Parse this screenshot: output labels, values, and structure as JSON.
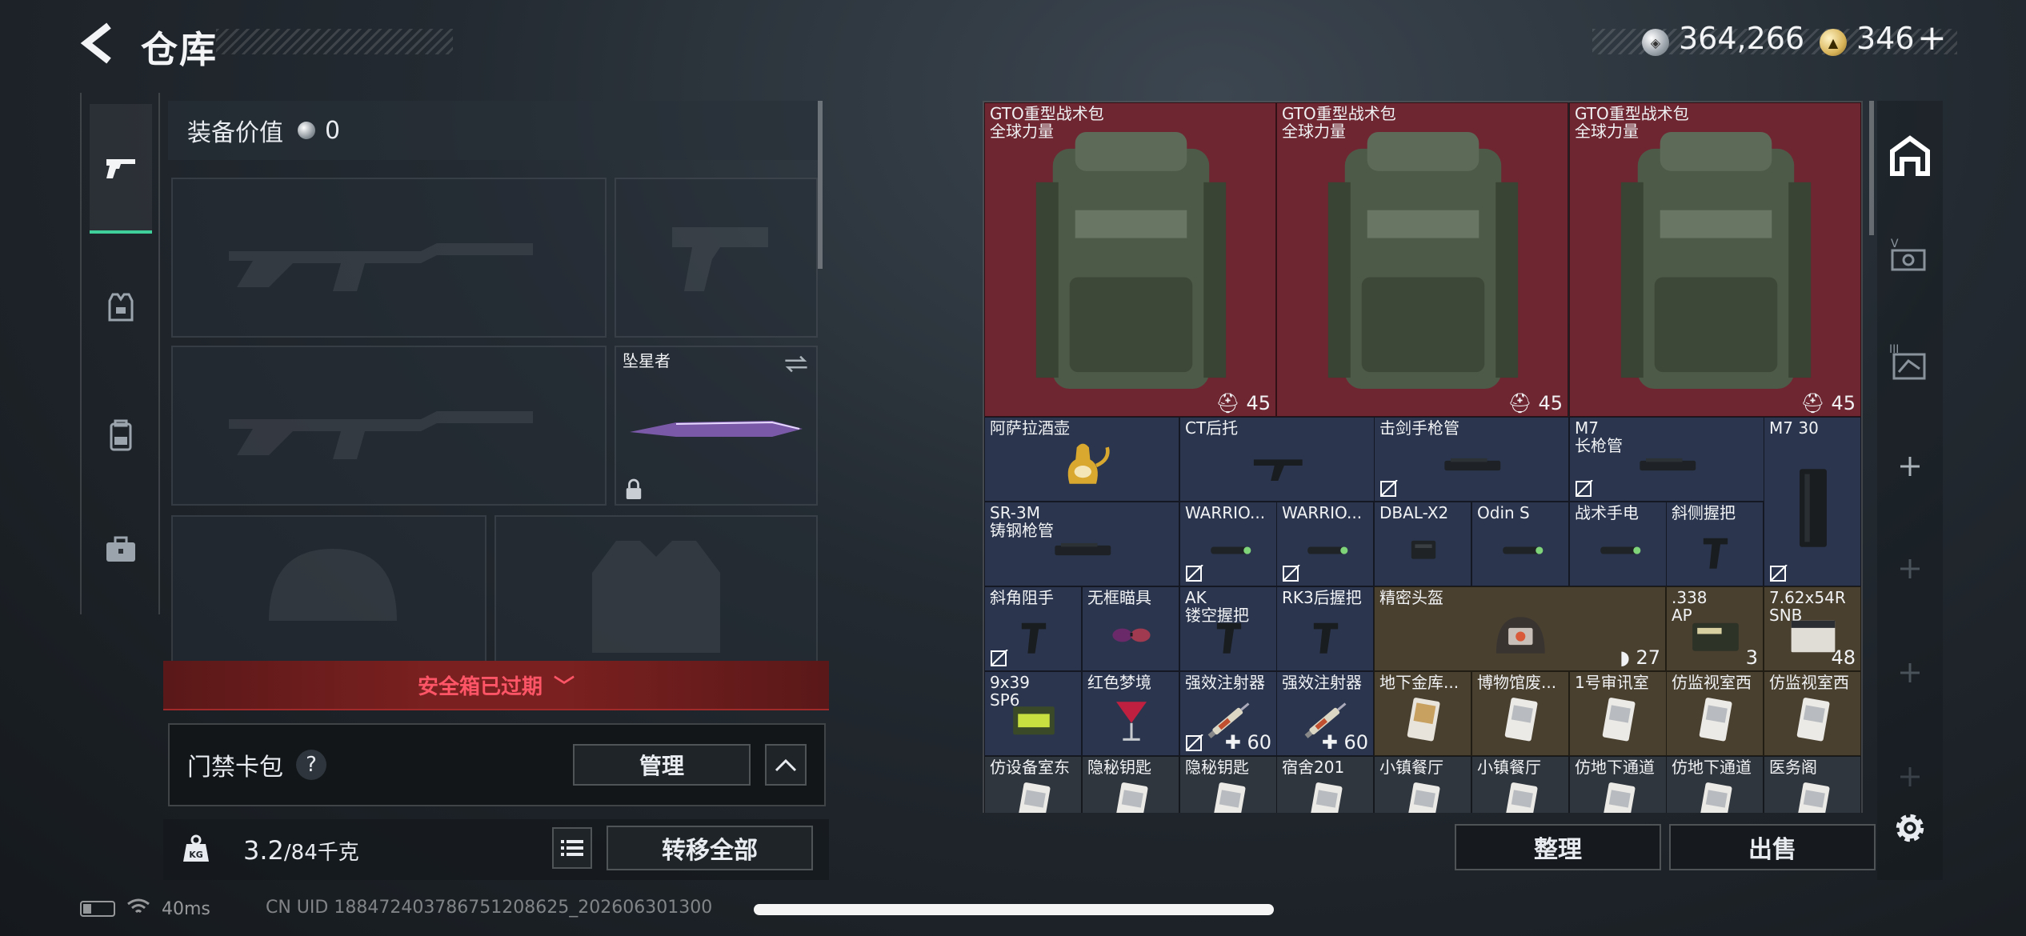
{
  "header": {
    "title": "仓库",
    "silver_amount": "364,266",
    "gold_amount": "346",
    "gold_plus": "+"
  },
  "categories": [
    {
      "name": "weapon",
      "icon": "pistol-icon",
      "active": true
    },
    {
      "name": "armor",
      "icon": "vest-icon",
      "active": false
    },
    {
      "name": "backpack",
      "icon": "backpack-icon",
      "active": false
    },
    {
      "name": "supplies",
      "icon": "briefcase-icon",
      "active": false
    }
  ],
  "equipment": {
    "value_label": "装备价值",
    "value": "0",
    "melee_name": "坠星者"
  },
  "safe_box": {
    "expired_text": "安全箱已过期"
  },
  "card_pack": {
    "label": "门禁卡包",
    "help": "?",
    "manage_label": "管理"
  },
  "weight": {
    "current": "3.2",
    "max": "/84千克",
    "transfer_all_label": "转移全部"
  },
  "inventory": [
    {
      "name": "GTO重型战术包",
      "sub": "全球力量",
      "count": "45",
      "count_icon": "backpack-count-icon",
      "color": "red"
    },
    {
      "name": "GTO重型战术包",
      "sub": "全球力量",
      "count": "45",
      "count_icon": "backpack-count-icon",
      "color": "red"
    },
    {
      "name": "GTO重型战术包",
      "sub": "全球力量",
      "count": "45",
      "count_icon": "backpack-count-icon",
      "color": "red"
    },
    {
      "name": "阿萨拉酒壶",
      "color": "blue"
    },
    {
      "name": "CT后托",
      "color": "blue"
    },
    {
      "name": "击剑手枪管",
      "color": "blue",
      "no_mark": true
    },
    {
      "name": "M7",
      "sub": "长枪管",
      "color": "blue",
      "no_mark": true
    },
    {
      "name": "M7 30",
      "color": "blue",
      "no_mark": true
    },
    {
      "name": "SR-3M",
      "sub": "铸钢枪管",
      "color": "blue"
    },
    {
      "name": "WARRIO...",
      "color": "blue",
      "no_mark": true
    },
    {
      "name": "WARRIO...",
      "color": "blue",
      "no_mark": true
    },
    {
      "name": "DBAL-X2",
      "color": "blue"
    },
    {
      "name": "Odin S",
      "color": "blue"
    },
    {
      "name": "战术手电",
      "color": "blue"
    },
    {
      "name": "斜侧握把",
      "color": "blue"
    },
    {
      "name": "斜角阻手",
      "color": "blue",
      "no_mark": true
    },
    {
      "name": "无框瞄具",
      "color": "blue"
    },
    {
      "name": "AK",
      "sub": "镂空握把",
      "color": "blue"
    },
    {
      "name": "RK3后握把",
      "color": "blue"
    },
    {
      "name": "精密头盔",
      "count": "27",
      "count_icon": "shield-count-icon",
      "color": "olive"
    },
    {
      "name": ".338",
      "sub": "AP",
      "count": "3",
      "color": "olive"
    },
    {
      "name": "7.62x54R",
      "sub": "SNB",
      "count": "48",
      "color": "olive"
    },
    {
      "name": "9x39",
      "sub": "SP6",
      "color": "blue"
    },
    {
      "name": "红色梦境",
      "color": "blue"
    },
    {
      "name": "强效注射器",
      "count": "60",
      "count_icon": "plus-count-icon",
      "color": "blue",
      "no_mark": true
    },
    {
      "name": "强效注射器",
      "count": "60",
      "count_icon": "plus-count-icon",
      "color": "blue"
    },
    {
      "name": "地下金库...",
      "color": "olive"
    },
    {
      "name": "博物馆废...",
      "color": "olive"
    },
    {
      "name": "1号审讯室",
      "color": "olive"
    },
    {
      "name": "仿监视室西",
      "color": "olive"
    },
    {
      "name": "仿监视室西",
      "color": "olive"
    },
    {
      "name": "仿设备室东",
      "color": "gray"
    },
    {
      "name": "隐秘钥匙",
      "color": "gray"
    },
    {
      "name": "隐秘钥匙",
      "color": "gray"
    },
    {
      "name": "宿舍201",
      "color": "gray"
    },
    {
      "name": "小镇餐厅",
      "color": "gray"
    },
    {
      "name": "小镇餐厅",
      "color": "gray"
    },
    {
      "name": "仿地下通道",
      "color": "gray"
    },
    {
      "name": "仿地下通道",
      "color": "gray"
    },
    {
      "name": "医务阁",
      "color": "gray"
    }
  ],
  "actions": {
    "tidy_label": "整理",
    "sell_label": "出售"
  },
  "side_tabs": [
    {
      "icon": "warehouse-icon",
      "active": true
    },
    {
      "icon": "warehouse-2-icon",
      "label": "V"
    },
    {
      "icon": "warehouse-3-icon",
      "label": "III"
    },
    {
      "icon": "add-icon"
    },
    {
      "icon": "add-icon-disabled"
    },
    {
      "icon": "add-icon-disabled"
    },
    {
      "icon": "add-icon-disabled"
    },
    {
      "icon": "gear-icon"
    }
  ],
  "status_bar": {
    "ping": "40ms",
    "uid": "CN UID 18847240378675120​8625_202606301300"
  },
  "colors": {
    "accent": "#3ecf9a",
    "cell_red": "#6e2630",
    "cell_blue": "#2b364e",
    "cell_olive": "#4a4030",
    "warning": "#ff5566"
  }
}
